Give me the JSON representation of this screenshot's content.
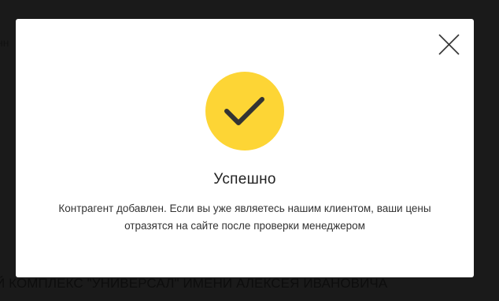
{
  "background": {
    "top_text": "нн",
    "bottom_text": "Й КОМПЛЕКС \"УНИВЕРСАЛ\" ИМЕНИ АЛЕКСЕЯ ИВАНОВИЧА"
  },
  "modal": {
    "title": "Успешно",
    "message": "Контрагент добавлен. Если вы уже являетесь нашим клиентом, ваши цены отразятся на сайте после проверки менеджером",
    "icon": "check-icon",
    "close_icon": "close-icon",
    "colors": {
      "accent": "#fdd535",
      "check": "#333333",
      "overlay": "#1a1a1a"
    }
  }
}
